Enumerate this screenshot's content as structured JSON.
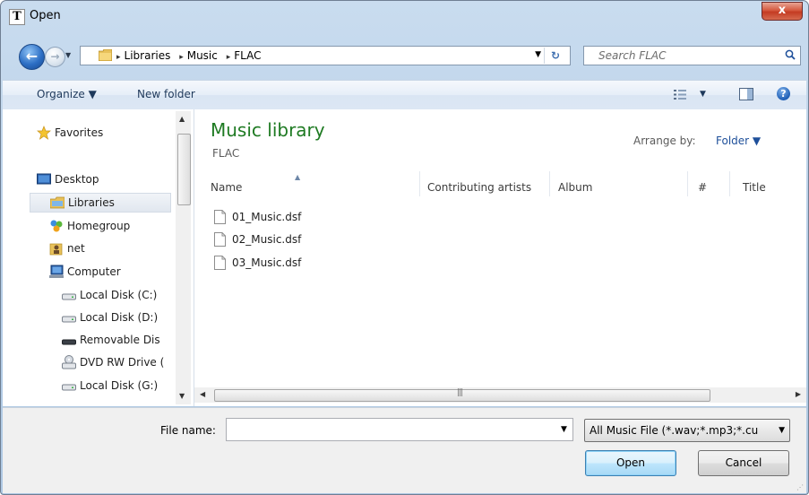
{
  "window": {
    "title": "Open",
    "close_label": "x"
  },
  "nav": {
    "back_arrow": "←",
    "forward_arrow": "→",
    "history_dropdown": "▼",
    "breadcrumbs": [
      "Libraries",
      "Music",
      "FLAC"
    ],
    "crumb_separator": "▸",
    "address_dropdown": "▼",
    "refresh_glyph": "↻",
    "search_placeholder": "Search FLAC"
  },
  "toolbar": {
    "organize_label": "Organize ▼",
    "new_folder_label": "New folder",
    "views_dropdown": "▼",
    "help_glyph": "?"
  },
  "sidebar": {
    "items": [
      {
        "label": "Favorites",
        "icon": "star-icon"
      },
      {
        "label": "Desktop",
        "icon": "desktop-icon"
      },
      {
        "label": "Libraries",
        "icon": "libraries-icon",
        "selected": true
      },
      {
        "label": "Homegroup",
        "icon": "homegroup-icon"
      },
      {
        "label": "net",
        "icon": "user-folder-icon"
      },
      {
        "label": "Computer",
        "icon": "computer-icon"
      },
      {
        "label": "Local Disk (C:)",
        "icon": "drive-icon"
      },
      {
        "label": "Local Disk (D:)",
        "icon": "drive-icon"
      },
      {
        "label": "Removable Dis",
        "icon": "removable-drive-icon"
      },
      {
        "label": "DVD RW Drive (",
        "icon": "dvd-drive-icon"
      },
      {
        "label": "Local Disk (G:)",
        "icon": "drive-icon"
      }
    ]
  },
  "main": {
    "library_title": "Music library",
    "library_subtitle": "FLAC",
    "arrange_label": "Arrange by:",
    "arrange_value": "Folder ▼",
    "columns": [
      "Name",
      "Contributing artists",
      "Album",
      "#",
      "Title"
    ],
    "files": [
      {
        "name": "01_Music.dsf"
      },
      {
        "name": "02_Music.dsf"
      },
      {
        "name": "03_Music.dsf"
      }
    ]
  },
  "footer": {
    "file_name_label": "File name:",
    "file_name_value": "",
    "filter_value": "All Music File (*.wav;*.mp3;*.cu",
    "open_label": "Open",
    "cancel_label": "Cancel"
  },
  "colors": {
    "library_title": "#1e7a22",
    "link_blue": "#1e4f9a",
    "title_bar": "#b5cde6"
  }
}
